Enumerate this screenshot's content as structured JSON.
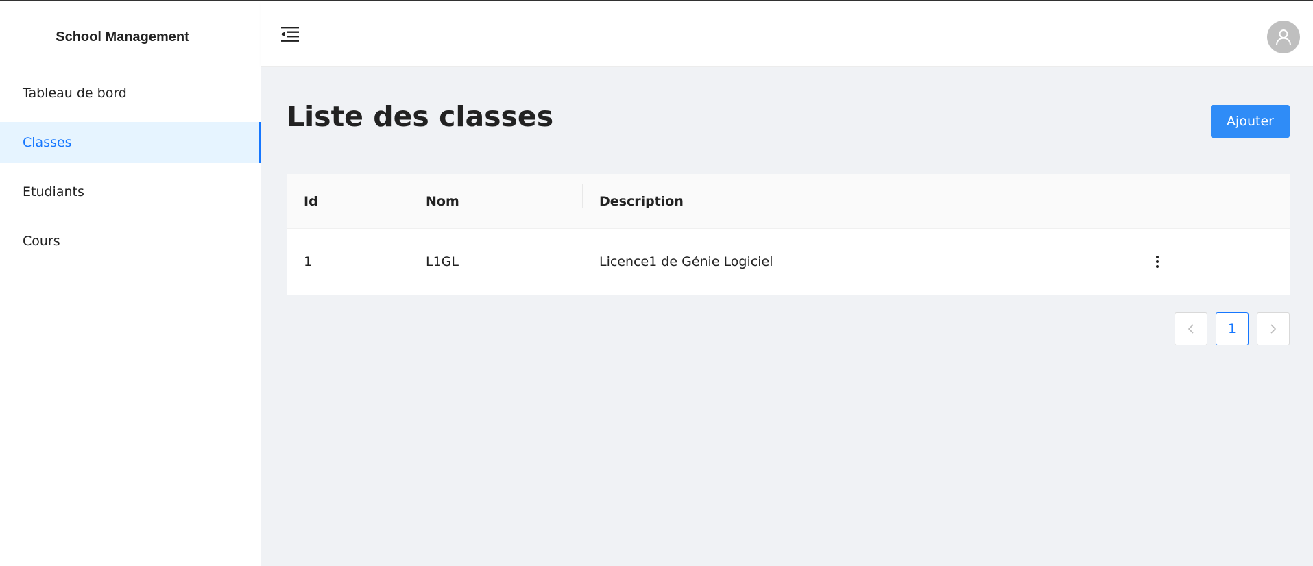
{
  "app": {
    "title": "School Management"
  },
  "sidebar": {
    "items": [
      {
        "label": "Tableau de bord",
        "active": false
      },
      {
        "label": "Classes",
        "active": true
      },
      {
        "label": "Etudiants",
        "active": false
      },
      {
        "label": "Cours",
        "active": false
      }
    ]
  },
  "header": {
    "menu_toggle_icon": "menu-fold-icon",
    "avatar_icon": "user-icon"
  },
  "main": {
    "title": "Liste des classes",
    "add_label": "Ajouter",
    "table": {
      "columns": [
        "Id",
        "Nom",
        "Description",
        ""
      ],
      "rows": [
        {
          "id": "1",
          "nom": "L1GL",
          "description": "Licence1 de Génie Logiciel"
        }
      ]
    },
    "pagination": {
      "current_page": "1",
      "prev_icon": "chevron-left-icon",
      "next_icon": "chevron-right-icon"
    }
  },
  "colors": {
    "accent": "#1677ff",
    "background": "#f0f2f5",
    "active_menu_bg": "#e6f4ff"
  }
}
